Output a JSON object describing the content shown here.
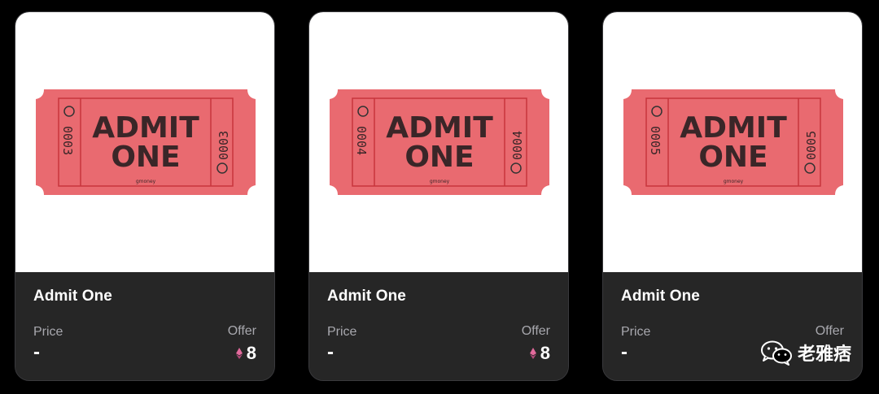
{
  "cards": [
    {
      "title": "Admit One",
      "price_label": "Price",
      "price_value": "-",
      "offer_label": "Offer",
      "offer_value": "8",
      "ticket": {
        "headline1": "ADMIT",
        "headline2": "ONE",
        "serial": "0003",
        "brand": "gmoney"
      }
    },
    {
      "title": "Admit One",
      "price_label": "Price",
      "price_value": "-",
      "offer_label": "Offer",
      "offer_value": "8",
      "ticket": {
        "headline1": "ADMIT",
        "headline2": "ONE",
        "serial": "0004",
        "brand": "gmoney"
      }
    },
    {
      "title": "Admit One",
      "price_label": "Price",
      "price_value": "-",
      "offer_label": "Offer",
      "offer_value": "",
      "ticket": {
        "headline1": "ADMIT",
        "headline2": "ONE",
        "serial": "0005",
        "brand": "gmoney"
      }
    }
  ],
  "watermark": {
    "text": "老雅痞",
    "icon": "wechat-icon"
  },
  "colors": {
    "page_bg": "#000000",
    "card_footer": "#262626",
    "ticket_red": "#e96a70",
    "ticket_line": "#c8343c",
    "eth_pink": "#e26a9c"
  },
  "icons": {
    "currency": "eth-icon"
  }
}
